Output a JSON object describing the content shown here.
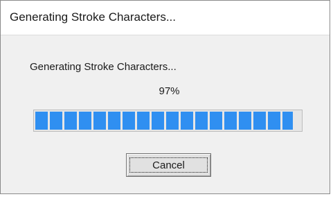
{
  "window": {
    "title": "Generating Stroke Characters..."
  },
  "dialog": {
    "message": "Generating Stroke Characters...",
    "percent_text": "97%",
    "progress_fraction": 0.97,
    "progress_color": "#2f8ff1"
  },
  "buttons": {
    "cancel_label": "Cancel"
  }
}
